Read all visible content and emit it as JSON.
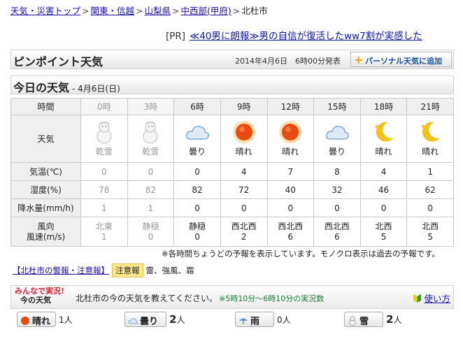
{
  "breadcrumb": {
    "items": [
      "天気・災害トップ",
      "関東・信越",
      "山梨県",
      "中西部(甲府)"
    ],
    "current": "北杜市"
  },
  "ad": {
    "tag": "[PR]",
    "text": "≪40男に朗報≫男の自信が復活したww7割が実感した"
  },
  "pinpoint": {
    "title": "ピンポイント天気",
    "published": "2014年4月6日　6時00分発表",
    "add_button": "パーソナル天気に追加"
  },
  "today": {
    "title": "今日の天気",
    "date": "- 4月6日(日)"
  },
  "forecast": {
    "row_labels": {
      "time": "時間",
      "weather": "天気",
      "temp": "気温(℃)",
      "humidity": "湿度(%)",
      "rain": "降水量(mm/h)",
      "wind_line1": "風向",
      "wind_line2": "風速(m/s)"
    },
    "columns": [
      {
        "time": "0時",
        "past": true,
        "icon": "snowman-icon",
        "weather": "乾雪",
        "temp": "0",
        "humidity": "78",
        "rain": "1",
        "wind_dir": "北東",
        "wind_speed": "1"
      },
      {
        "time": "3時",
        "past": true,
        "icon": "snowman-icon",
        "weather": "乾雪",
        "temp": "0",
        "humidity": "82",
        "rain": "1",
        "wind_dir": "静穏",
        "wind_speed": "0"
      },
      {
        "time": "6時",
        "past": false,
        "icon": "cloud-icon",
        "weather": "曇り",
        "temp": "0",
        "humidity": "82",
        "rain": "0",
        "wind_dir": "静穏",
        "wind_speed": "0"
      },
      {
        "time": "9時",
        "past": false,
        "icon": "sun-icon",
        "weather": "晴れ",
        "temp": "4",
        "humidity": "72",
        "rain": "0",
        "wind_dir": "西北西",
        "wind_speed": "2"
      },
      {
        "time": "12時",
        "past": false,
        "icon": "sun-icon",
        "weather": "晴れ",
        "temp": "7",
        "humidity": "40",
        "rain": "0",
        "wind_dir": "西北西",
        "wind_speed": "6"
      },
      {
        "time": "15時",
        "past": false,
        "icon": "cloud-icon",
        "weather": "曇り",
        "temp": "8",
        "humidity": "32",
        "rain": "0",
        "wind_dir": "西北西",
        "wind_speed": "6"
      },
      {
        "time": "18時",
        "past": false,
        "icon": "moon-icon",
        "weather": "晴れ",
        "temp": "4",
        "humidity": "46",
        "rain": "0",
        "wind_dir": "北西",
        "wind_speed": "5"
      },
      {
        "time": "21時",
        "past": false,
        "icon": "moon-icon",
        "weather": "晴れ",
        "temp": "1",
        "humidity": "62",
        "rain": "0",
        "wind_dir": "北西",
        "wind_speed": "5"
      }
    ],
    "note": "※各時間ちょうどの予報を表示しています。モノクロ表示は過去の予報です。"
  },
  "alerts": {
    "link": "【北杜市の警報・注意報】",
    "badge": "注意報",
    "items": "雷、強風、霜"
  },
  "minna": {
    "logo_line1": "みんなで実況!",
    "logo_line2": "今の天気",
    "question": "北杜市の今の天気を教えてください。",
    "period": "※5時10分〜6時10分の実況数",
    "howto": "使い方"
  },
  "votes": [
    {
      "label": "晴れ",
      "icon": "sun-icon",
      "count": "1",
      "unit": "人"
    },
    {
      "label": "曇り",
      "icon": "cloud-icon",
      "count": "2",
      "unit": "人"
    },
    {
      "label": "雨",
      "icon": "umbrella-icon",
      "count": "0",
      "unit": "人"
    },
    {
      "label": "雪",
      "icon": "snowman-icon",
      "count": "2",
      "unit": "人"
    }
  ],
  "colors": {
    "link": "#1a0dab",
    "sun": "#e84a10",
    "moon": "#f2c21b",
    "cloud": "#7fa9d8",
    "past_text": "#999999",
    "alert_badge": "#ffe88a"
  }
}
